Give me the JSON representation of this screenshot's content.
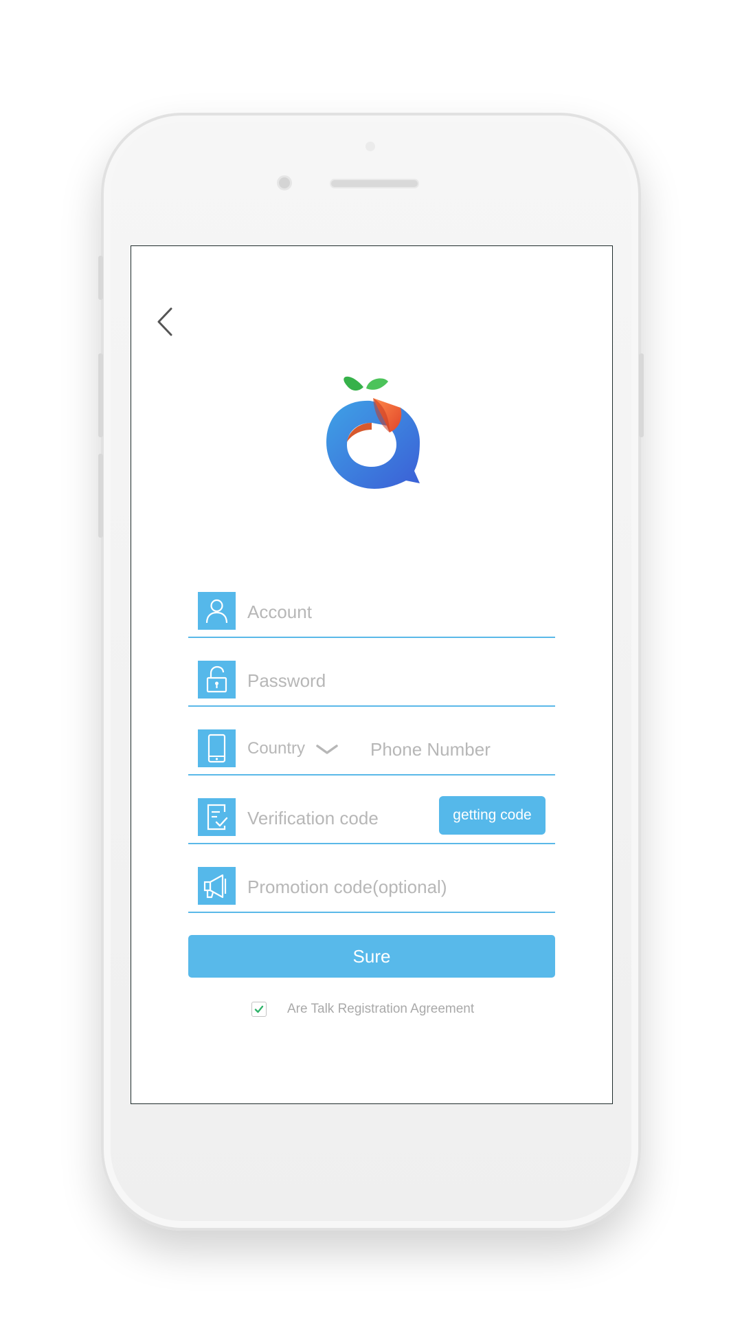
{
  "form": {
    "account_placeholder": "Account",
    "password_placeholder": "Password",
    "country_label": "Country",
    "phone_placeholder": "Phone Number",
    "verification_placeholder": "Verification code",
    "getting_code_label": "getting code",
    "promotion_placeholder": "Promotion code(optional)"
  },
  "submit_label": "Sure",
  "agreement": {
    "checked": true,
    "text": "Are Talk Registration Agreement"
  },
  "colors": {
    "accent": "#55b8ea",
    "check": "#2fb36a",
    "placeholder": "#b7b7b7"
  },
  "icons": {
    "back": "chevron-left-icon",
    "account": "user-icon",
    "password": "lock-icon",
    "phone": "phone-icon",
    "verification": "verification-icon",
    "promotion": "megaphone-icon",
    "dropdown": "chevron-down-icon",
    "check": "check-icon"
  }
}
